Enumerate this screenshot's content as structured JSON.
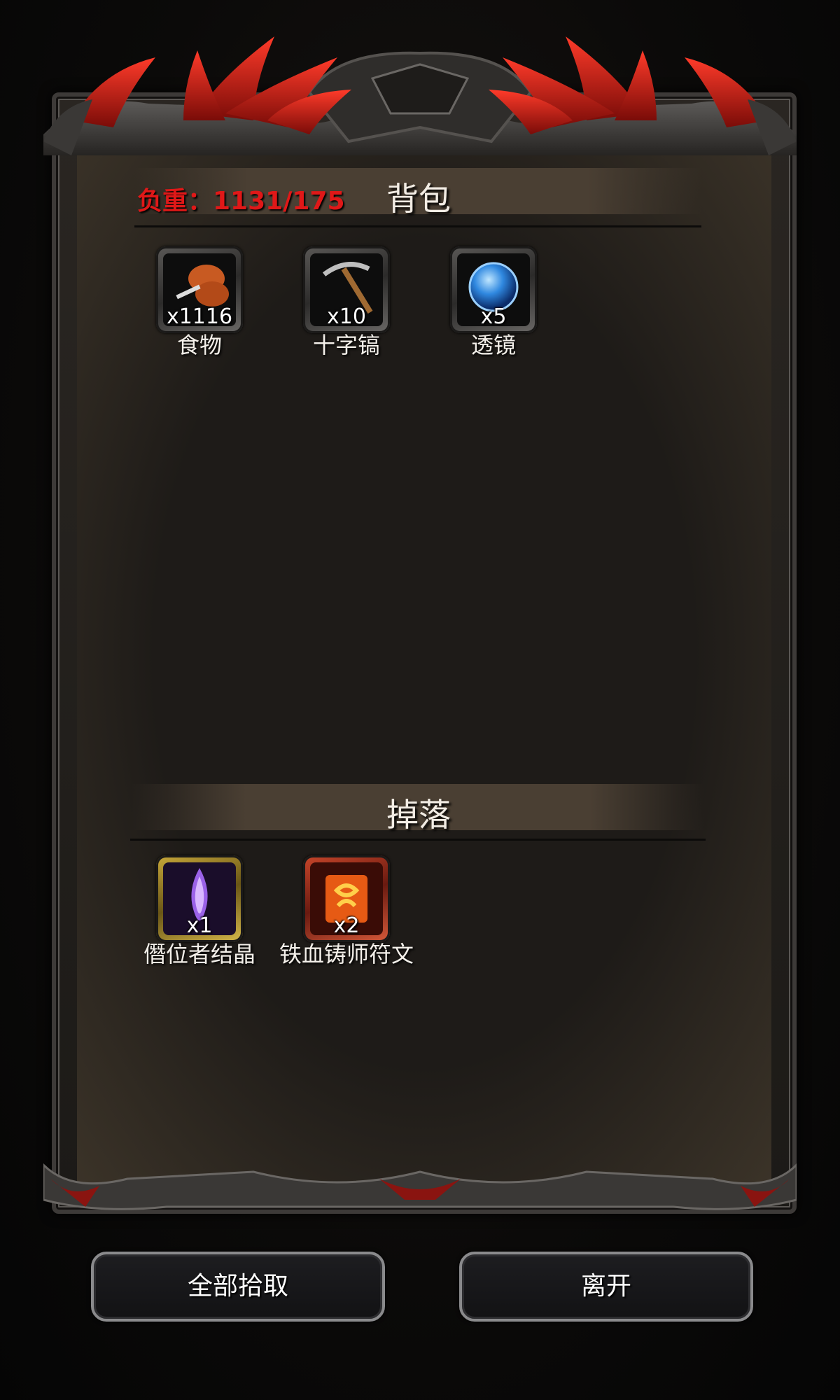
{
  "weight_label": "负重：1131/175",
  "backpack": {
    "title": "背包",
    "items": [
      {
        "icon": "food-icon",
        "quantity": "x1116",
        "name": "食物"
      },
      {
        "icon": "pickaxe-icon",
        "quantity": "x10",
        "name": "十字镐"
      },
      {
        "icon": "lens-icon",
        "quantity": "x5",
        "name": "透镜"
      }
    ]
  },
  "drops": {
    "title": "掉落",
    "items": [
      {
        "icon": "crystal-icon",
        "quantity": "x1",
        "name": "僭位者结晶"
      },
      {
        "icon": "rune-icon",
        "quantity": "x2",
        "name": "铁血铸师符文"
      }
    ]
  },
  "buttons": {
    "loot_all": "全部拾取",
    "leave": "离开"
  },
  "colors": {
    "weight_text": "#e01818",
    "ornament_red": "#c8221a",
    "frame_metal": "#5a5754"
  }
}
